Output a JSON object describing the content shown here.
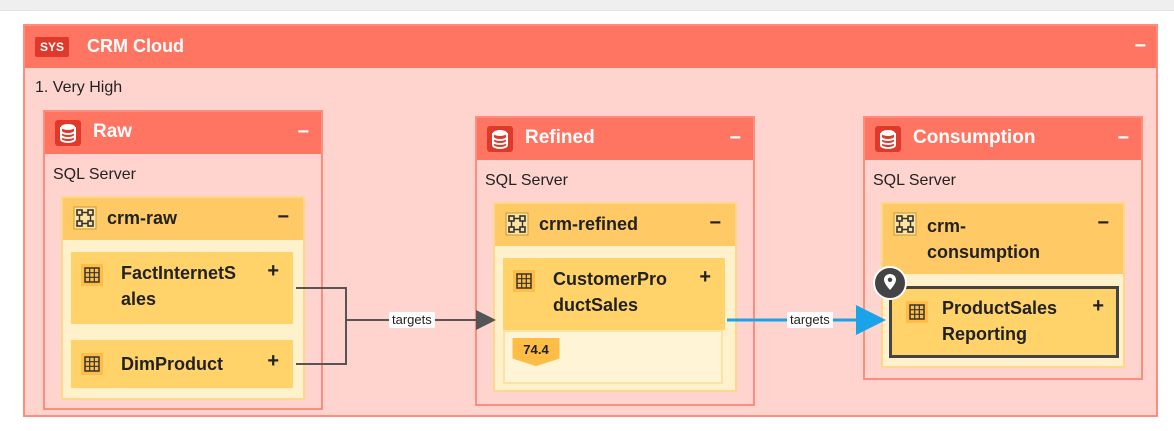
{
  "system": {
    "badge": "SYS",
    "title": "CRM Cloud",
    "subtitle": "1. Very High",
    "collapse": "−"
  },
  "zones": [
    {
      "title": "Raw",
      "technology": "SQL Server",
      "icon": "database-icon",
      "collapse": "−",
      "schema": {
        "title": "crm-raw",
        "icon": "schema-icon",
        "collapse": "−",
        "tables": [
          {
            "line1": "FactInternetS",
            "line2": "ales",
            "expand": "+",
            "icon": "table-icon"
          },
          {
            "line1": "DimProduct",
            "line2": "",
            "expand": "+",
            "icon": "table-icon"
          }
        ]
      }
    },
    {
      "title": "Refined",
      "technology": "SQL Server",
      "icon": "database-icon",
      "collapse": "−",
      "schema": {
        "title": "crm-refined",
        "icon": "schema-icon",
        "collapse": "−",
        "tables": [
          {
            "line1": "CustomerPro",
            "line2": "ductSales",
            "expand": "+",
            "icon": "table-icon",
            "score": "74.4"
          }
        ]
      }
    },
    {
      "title": "Consumption",
      "technology": "SQL Server",
      "icon": "database-icon",
      "collapse": "−",
      "schema": {
        "title_line1": "crm-",
        "title_line2": "consumption",
        "icon": "schema-icon",
        "collapse": "−",
        "tables": [
          {
            "line1": "ProductSales",
            "line2": "Reporting",
            "expand": "+",
            "icon": "table-icon",
            "pin_icon": "location-pin-icon",
            "selected": true
          }
        ]
      }
    }
  ],
  "edges": [
    {
      "label": "targets",
      "color": "#555555"
    },
    {
      "label": "targets",
      "color": "#1aa3e8"
    }
  ],
  "colors": {
    "system_fill": "#ffd4ce",
    "system_header": "#ff7562",
    "schema_header": "#ffca66",
    "table_fill": "#ffd36a",
    "highlight_edge": "#1aa3e8"
  }
}
